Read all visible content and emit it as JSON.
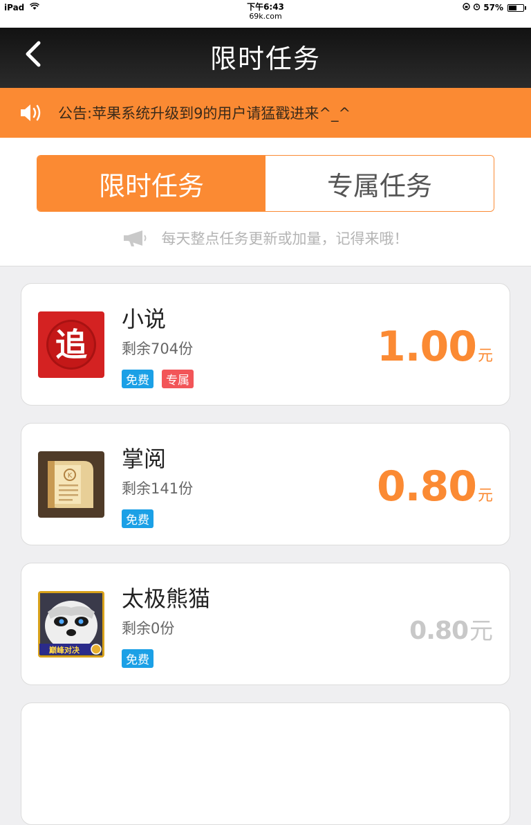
{
  "status_bar": {
    "device": "iPad",
    "time": "下午6:43",
    "url": "69k.com",
    "battery_percent": "57%",
    "battery_level": 0.57
  },
  "nav": {
    "title": "限时任务",
    "back_icon": "chevron-left-icon"
  },
  "notice": {
    "icon": "speaker-icon",
    "text": "公告:苹果系统升级到9的用户请猛戳进来^_^"
  },
  "tabs": [
    {
      "label": "限时任务",
      "active": true
    },
    {
      "label": "专属任务",
      "active": false
    }
  ],
  "tip": {
    "icon": "megaphone-icon",
    "text": "每天整点任务更新或加量，记得来哦！"
  },
  "colors": {
    "accent": "#fb8a33",
    "badge_free": "#1ba0e6",
    "badge_exclusive": "#f25558"
  },
  "tasks": [
    {
      "name": "小说",
      "remaining": "剩余704份",
      "badges": [
        "免费",
        "专属"
      ],
      "price": "1.00",
      "unit": "元",
      "icon": "zhui-novel-app-icon",
      "available": true
    },
    {
      "name": "掌阅",
      "remaining": "剩余141份",
      "badges": [
        "免费"
      ],
      "price": "0.80",
      "unit": "元",
      "icon": "zhangyue-book-app-icon",
      "available": true
    },
    {
      "name": "太极熊猫",
      "remaining": "剩余0份",
      "badges": [
        "免费"
      ],
      "price": "0.80",
      "unit": "元",
      "icon": "taiji-panda-game-icon",
      "available": false
    }
  ]
}
